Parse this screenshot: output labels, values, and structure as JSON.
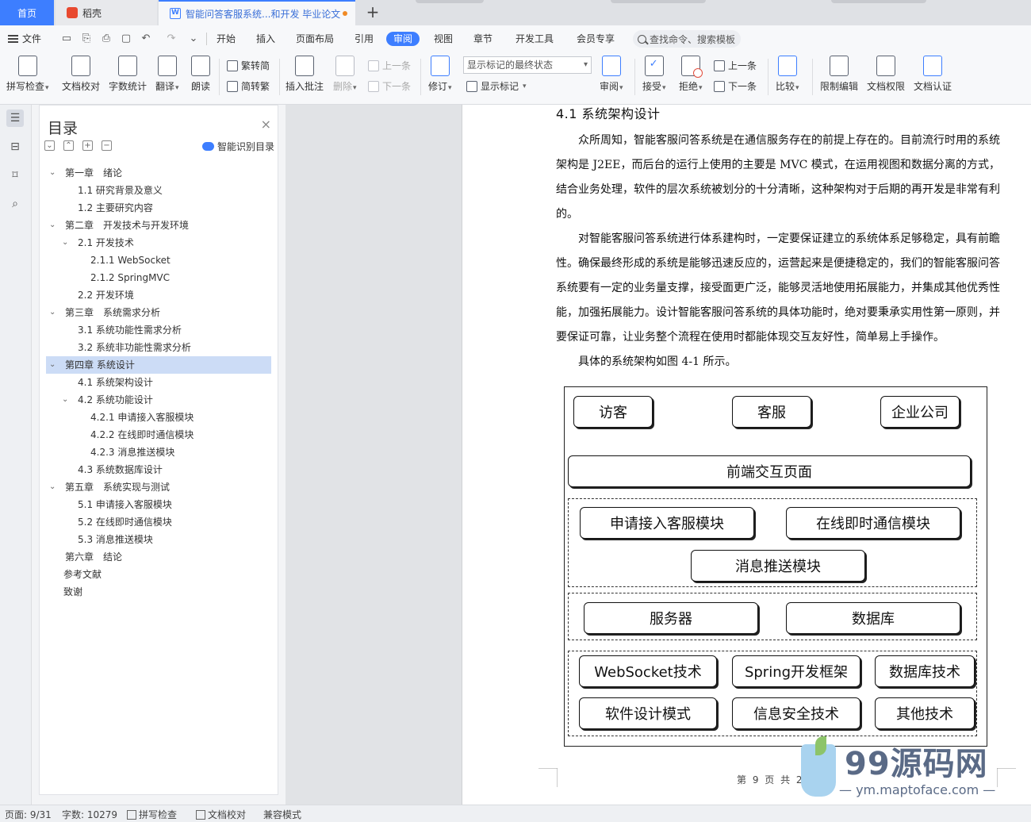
{
  "tabs": {
    "home": "首页",
    "daoke": "稻壳",
    "doc": "智能问答客服系统...和开发 毕业论文",
    "add": "+"
  },
  "menubar": {
    "file": "文件",
    "items": [
      "开始",
      "插入",
      "页面布局",
      "引用",
      "审阅",
      "视图",
      "章节",
      "开发工具",
      "会员专享"
    ],
    "active": "审阅",
    "search": "查找命令、搜索模板"
  },
  "ribbon": {
    "spellcheck": "拼写检查",
    "doccheck": "文档校对",
    "wordcount": "字数统计",
    "translate": "翻译",
    "read": "朗读",
    "trad": "繁转简",
    "simp": "简转繁",
    "insert_comment": "插入批注",
    "delete": "删除",
    "prev": "上一条",
    "next": "下一条",
    "revise": "修订",
    "markup_state": "显示标记的最终状态",
    "show_markup": "显示标记",
    "review": "审阅",
    "accept": "接受",
    "reject": "拒绝",
    "prev2": "上一条",
    "next2": "下一条",
    "compare": "比较",
    "restrict": "限制编辑",
    "rights": "文档权限",
    "auth": "文档认证"
  },
  "toc": {
    "title": "目录",
    "close": "×",
    "smart": "智能识别目录",
    "items": [
      {
        "label": "第一章　绪论",
        "level": 1,
        "expandable": true
      },
      {
        "label": "1.1  研究背景及意义",
        "level": 2,
        "expandable": false
      },
      {
        "label": "1.2  主要研究内容",
        "level": 2,
        "expandable": false
      },
      {
        "label": "第二章　开发技术与开发环境",
        "level": 1,
        "expandable": true
      },
      {
        "label": "2.1  开发技术",
        "level": 2,
        "expandable": true
      },
      {
        "label": "2.1.1 WebSocket",
        "level": 3,
        "expandable": false
      },
      {
        "label": "2.1.2 SpringMVC",
        "level": 3,
        "expandable": false
      },
      {
        "label": "2.2  开发环境",
        "level": 2,
        "expandable": false
      },
      {
        "label": "第三章　系统需求分析",
        "level": 1,
        "expandable": true
      },
      {
        "label": "3.1  系统功能性需求分析",
        "level": 2,
        "expandable": false
      },
      {
        "label": "3.2  系统非功能性需求分析",
        "level": 2,
        "expandable": false
      },
      {
        "label": "第四章  系统设计",
        "level": 1,
        "expandable": true,
        "selected": true
      },
      {
        "label": "4.1  系统架构设计",
        "level": 2,
        "expandable": false
      },
      {
        "label": "4.2  系统功能设计",
        "level": 2,
        "expandable": true
      },
      {
        "label": "4.2.1  申请接入客服模块",
        "level": 3,
        "expandable": false
      },
      {
        "label": "4.2.2  在线即时通信模块",
        "level": 3,
        "expandable": false
      },
      {
        "label": "4.2.3  消息推送模块",
        "level": 3,
        "expandable": false
      },
      {
        "label": "4.3  系统数据库设计",
        "level": 2,
        "expandable": false
      },
      {
        "label": "第五章　系统实现与测试",
        "level": 1,
        "expandable": true
      },
      {
        "label": "5.1  申请接入客服模块",
        "level": 2,
        "expandable": false
      },
      {
        "label": "5.2  在线即时通信模块",
        "level": 2,
        "expandable": false
      },
      {
        "label": "5.3  消息推送模块",
        "level": 2,
        "expandable": false
      },
      {
        "label": "第六章　结论",
        "level": 1,
        "expandable": false
      },
      {
        "label": "参考文献",
        "level": 0,
        "expandable": false
      },
      {
        "label": "致谢",
        "level": 0,
        "expandable": false
      }
    ]
  },
  "doc": {
    "heading": "4.1  系统架构设计",
    "p1": "众所周知，智能客服问答系统是在通信服务存在的前提上存在的。目前流行时用的系统架构是 J2EE，而后台的运行上使用的主要是 MVC 模式，在运用视图和数据分离的方式，结合业务处理，软件的层次系统被划分的十分清晰，这种架构对于后期的再开发是非常有利的。",
    "p2": "对智能客服问答系统进行体系建构时，一定要保证建立的系统体系足够稳定，具有前瞻性。确保最终形成的系统是能够迅速反应的，运营起来是便捷稳定的，我们的智能客服问答系统要有一定的业务量支撑，接受面更广泛，能够灵活地使用拓展能力，并集成其他优秀性能，加强拓展能力。设计智能客服问答系统的具体功能时，绝对要秉承实用性第一原则，并要保证可靠，让业务整个流程在使用时都能体现交互友好性，简单易上手操作。",
    "p3": "具体的系统架构如图 4-1 所示。",
    "diagram": {
      "visitor": "访客",
      "service": "客服",
      "company": "企业公司",
      "frontend": "前端交互页面",
      "mod1": "申请接入客服模块",
      "mod2": "在线即时通信模块",
      "mod3": "消息推送模块",
      "server": "服务器",
      "database": "数据库",
      "t1": "WebSocket技术",
      "t2": "Spring开发框架",
      "t3": "数据库技术",
      "t4": "软件设计模式",
      "t5": "信息安全技术",
      "t6": "其他技术"
    },
    "footer": "第 9 页 共 28 页"
  },
  "watermark": {
    "brand": "99源码网",
    "url": "— ym.maptoface.com —"
  },
  "status": {
    "page": "页面: 9/31",
    "words": "字数: 10279",
    "spell": "拼写检查",
    "doccheck": "文档校对",
    "compat": "兼容模式"
  }
}
